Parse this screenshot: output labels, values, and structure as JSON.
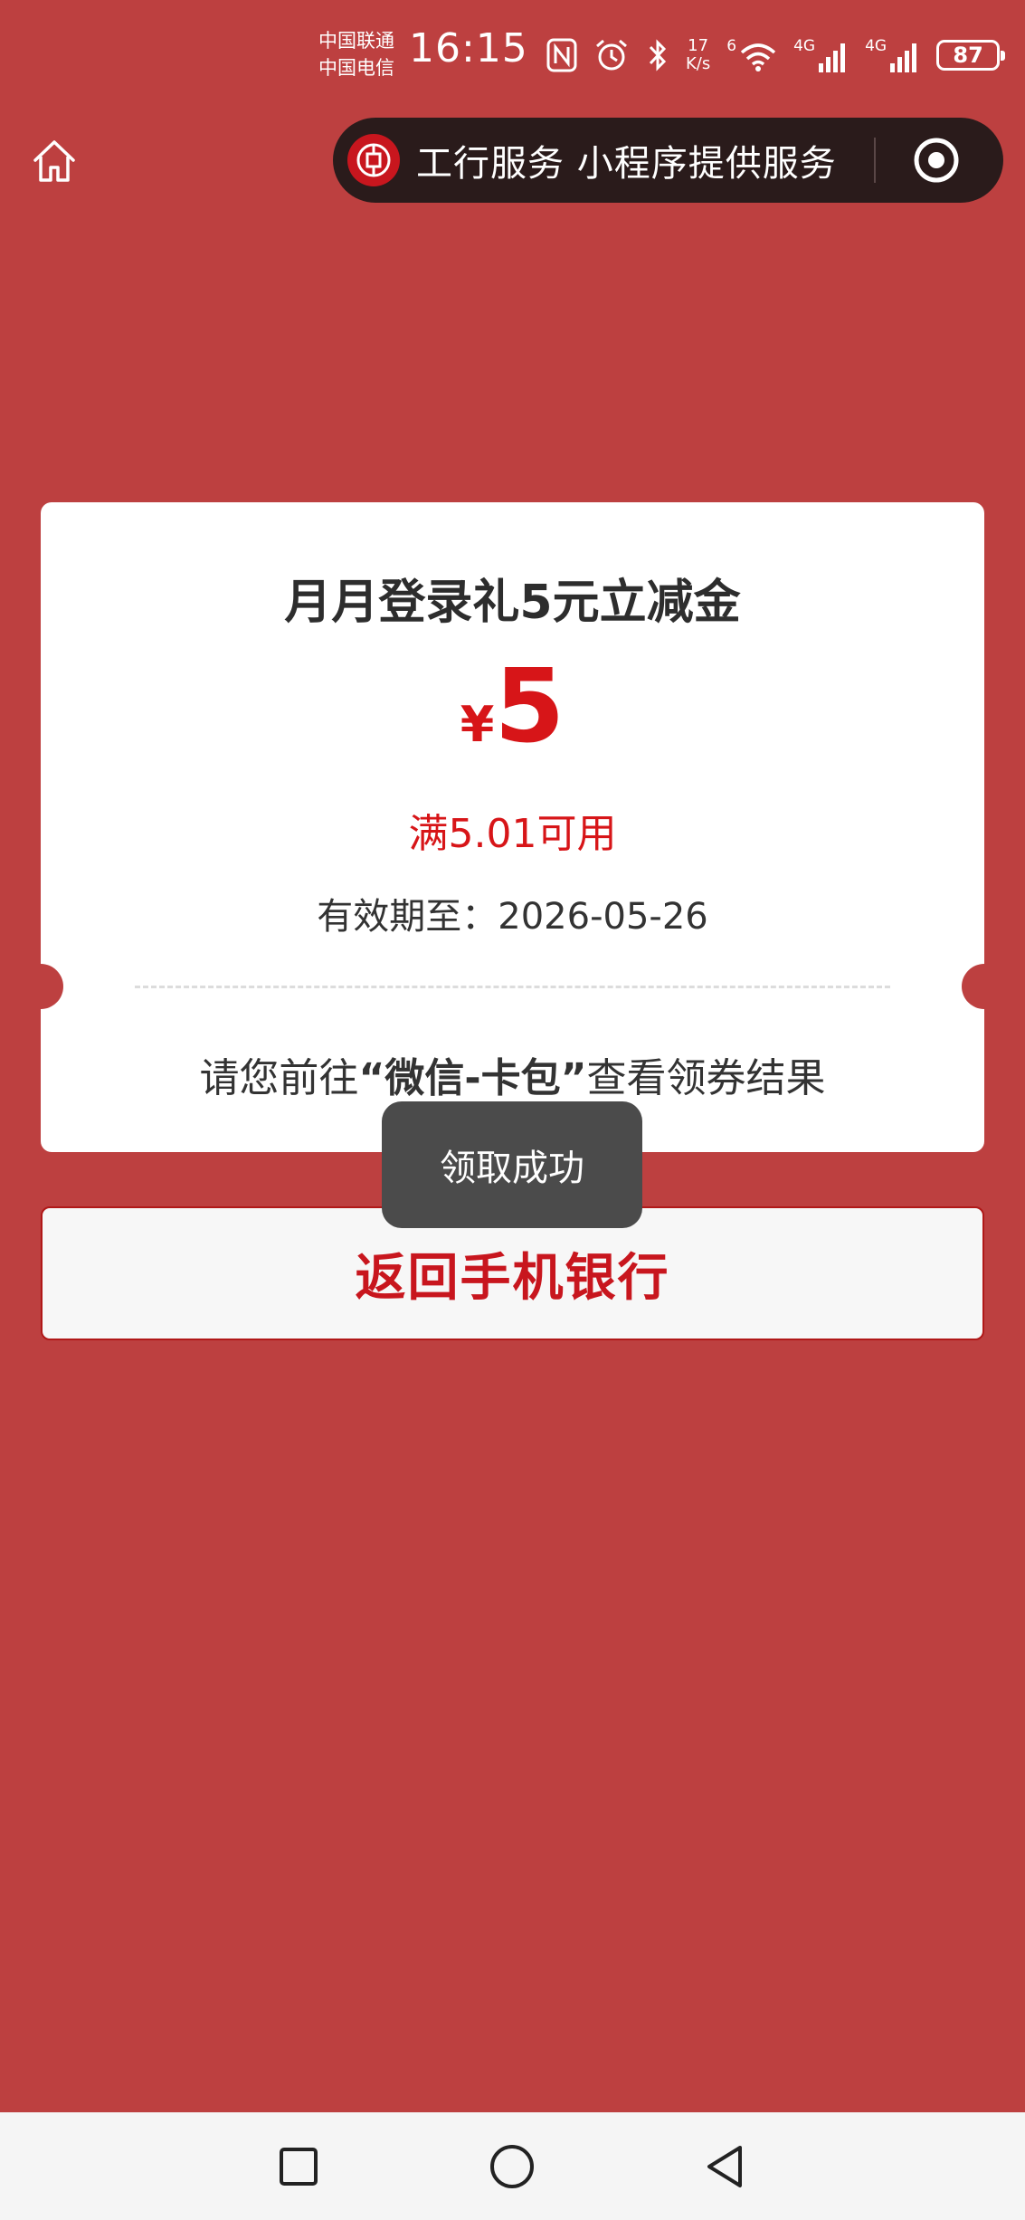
{
  "status_bar": {
    "carrier_1": "中国联通",
    "carrier_2": "中国电信",
    "time": "16:15",
    "speed_value": "17",
    "speed_unit": "K/s",
    "wifi_label": "6",
    "net_1_label": "4G",
    "net_2_label": "4G",
    "battery": "87"
  },
  "nav": {
    "capsule_text": "工行服务 小程序提供服务"
  },
  "coupon": {
    "title": "月月登录礼5元立减金",
    "currency": "¥",
    "amount": "5",
    "threshold": "满5.01可用",
    "validity_label": "有效期至：",
    "validity_date": "2026-05-26",
    "hint_prefix": "请您前往",
    "hint_emphasis": "“微信-卡包”",
    "hint_suffix": "查看领券结果"
  },
  "return_button": {
    "label": "返回手机银行"
  },
  "toast": {
    "text": "领取成功"
  },
  "colors": {
    "background": "#bd4040",
    "accent_red": "#d71518",
    "toast_bg": "#4b4b4b"
  }
}
